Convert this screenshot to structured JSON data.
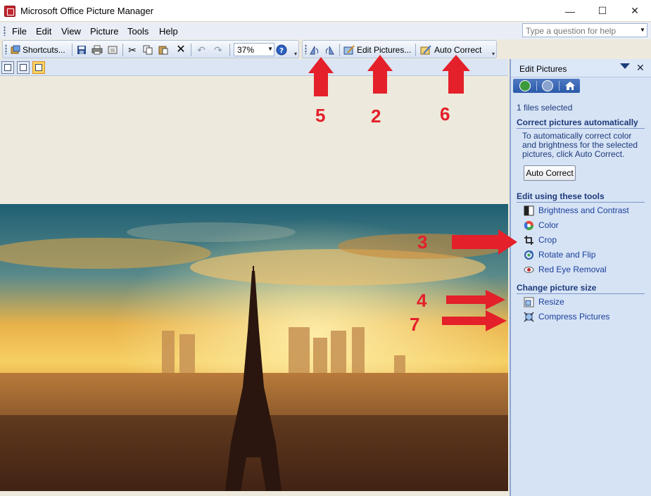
{
  "window": {
    "title": "Microsoft Office Picture Manager",
    "minimize": "—",
    "maximize": "☐",
    "close": "✕"
  },
  "menu": {
    "items": [
      "File",
      "Edit",
      "View",
      "Picture",
      "Tools",
      "Help"
    ],
    "help_placeholder": "Type a question for help"
  },
  "toolbar": {
    "shortcuts_label": "Shortcuts...",
    "zoom_value": "37%",
    "edit_pictures_label": "Edit Pictures...",
    "auto_correct_label": "Auto Correct"
  },
  "task_pane": {
    "title": "Edit Pictures",
    "files_selected": "1 files selected",
    "section_auto": "Correct pictures automatically",
    "auto_desc": "To automatically correct color and brightness for the selected pictures, click Auto Correct.",
    "auto_button": "Auto Correct",
    "section_tools": "Edit using these tools",
    "tools": [
      "Brightness and Contrast",
      "Color",
      "Crop",
      "Rotate and Flip",
      "Red Eye Removal"
    ],
    "section_size": "Change picture size",
    "size_tools": [
      "Resize",
      "Compress Pictures"
    ]
  },
  "annotations": {
    "n2": "2",
    "n3": "3",
    "n4": "4",
    "n5": "5",
    "n6": "6",
    "n7": "7"
  },
  "colors": {
    "accent": "#1d3a7a",
    "annotation": "#e4202a",
    "active_view": "#ffd35e"
  },
  "icons": [
    "app-icon",
    "shortcuts-icon",
    "save-icon",
    "print-icon",
    "email-icon",
    "cut-icon",
    "copy-icon",
    "paste-icon",
    "delete-icon",
    "undo-icon",
    "redo-icon",
    "help-icon",
    "rotate-left-icon",
    "rotate-right-icon",
    "edit-pictures-icon",
    "auto-correct-icon",
    "back-icon",
    "forward-icon",
    "home-icon"
  ]
}
